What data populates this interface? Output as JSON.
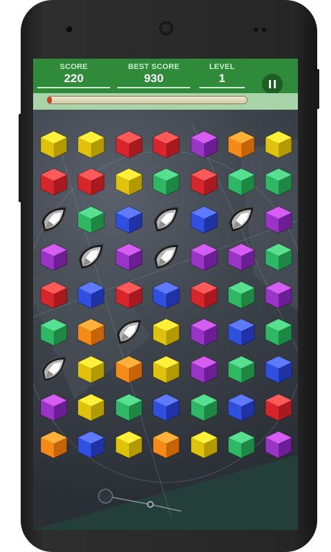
{
  "hud": {
    "score_label": "SCORE",
    "score": "220",
    "best_label": "BEST SCORE",
    "best": "930",
    "level_label": "LEVEL",
    "level": "1"
  },
  "progress": {
    "fraction": 0.02,
    "color": "#d2401f"
  },
  "colors": {
    "yellow": [
      "#fff03a",
      "#e0c20a",
      "#b39a00"
    ],
    "red": [
      "#ff5a5a",
      "#d7262b",
      "#a91a20"
    ],
    "green": [
      "#57e08f",
      "#2fb863",
      "#1f8744"
    ],
    "purple": [
      "#d55df2",
      "#9a34c7",
      "#6c1e94"
    ],
    "orange": [
      "#ffb23a",
      "#f58a17",
      "#c8630a"
    ],
    "blue": [
      "#5e7bff",
      "#2f4fe0",
      "#1f33a6"
    ],
    "diamond": [
      "#ffffff",
      "#b5b5b5",
      "#4a4a4a"
    ]
  },
  "board": [
    [
      "yellow",
      "yellow",
      "red",
      "red",
      "purple",
      "orange",
      "yellow"
    ],
    [
      "red",
      "red",
      "yellow",
      "green",
      "red",
      "green",
      "green"
    ],
    [
      "diamond",
      "green",
      "blue",
      "diamond",
      "blue",
      "diamond",
      "purple"
    ],
    [
      "purple",
      "diamond",
      "purple",
      "diamond",
      "purple",
      "purple",
      "green"
    ],
    [
      "red",
      "blue",
      "red",
      "blue",
      "red",
      "green",
      "purple"
    ],
    [
      "green",
      "orange",
      "diamond",
      "yellow",
      "purple",
      "blue",
      "green"
    ],
    [
      "diamond",
      "yellow",
      "orange",
      "yellow",
      "purple",
      "green",
      "blue"
    ],
    [
      "purple",
      "yellow",
      "green",
      "blue",
      "green",
      "blue",
      "red"
    ],
    [
      "orange",
      "blue",
      "yellow",
      "orange",
      "yellow",
      "green",
      "purple"
    ]
  ]
}
